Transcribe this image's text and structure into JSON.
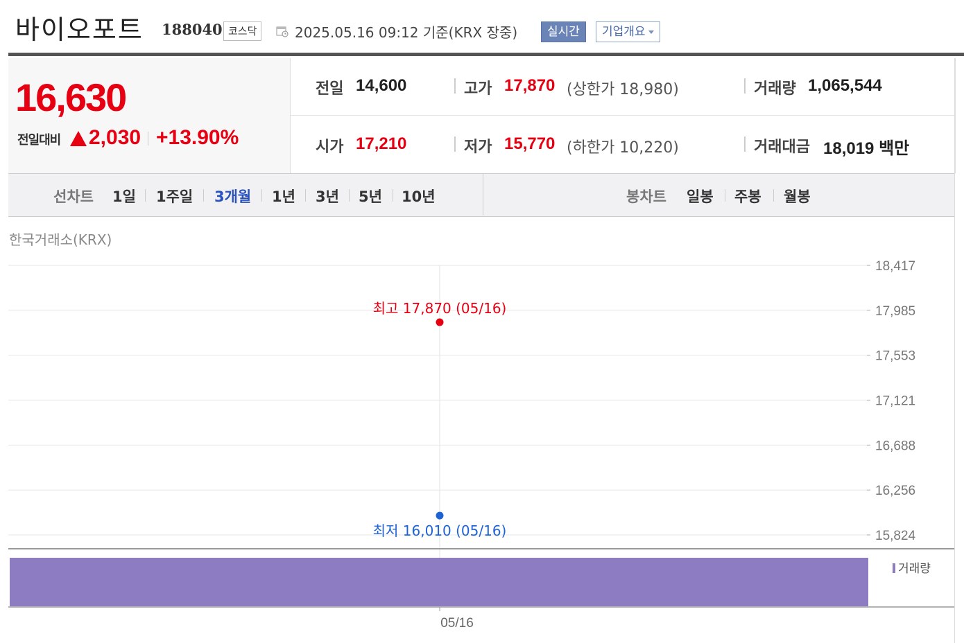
{
  "header": {
    "title": "바이오포트",
    "code": "188040",
    "market": "코스닥",
    "datetime": "2025.05.16 09:12  기준(KRX 장중)",
    "realtime_label": "실시간",
    "company_label": "기업개요"
  },
  "price": {
    "current": "16,630",
    "change_label": "전일대비",
    "change": "2,030",
    "change_pct": "+13.90%"
  },
  "stats": {
    "prev_close_label": "전일",
    "prev_close": "14,600",
    "high_label": "고가",
    "high": "17,870",
    "upper_limit_text": "(상한가 18,980)",
    "volume_label": "거래량",
    "volume": "1,065,544",
    "open_label": "시가",
    "open": "17,210",
    "low_label": "저가",
    "low": "15,770",
    "lower_limit_text": "(하한가 10,220)",
    "value_label": "거래대금",
    "value": "18,019 백만"
  },
  "tabs": {
    "line_label": "선차트",
    "line_tabs": [
      "1일",
      "1주일",
      "3개월",
      "1년",
      "3년",
      "5년",
      "10년"
    ],
    "active_tab": "3개월",
    "candle_label": "봉차트",
    "candle_tabs": [
      "일봉",
      "주봉",
      "월봉"
    ]
  },
  "chart": {
    "exchange_label": "한국거래소(KRX)",
    "volume_legend": "거래량",
    "colors": {
      "high": "#e60012",
      "low": "#1e63d6",
      "volume": "#8e7cc3",
      "grid": "#e6e6e6"
    }
  },
  "chart_data": {
    "type": "line",
    "x": [
      "05/16"
    ],
    "y_ticks": [
      18417,
      17985,
      17553,
      17121,
      16688,
      16256,
      15824
    ],
    "ylim": [
      15824,
      18417
    ],
    "annotations": [
      {
        "label": "최고 17,870 (05/16)",
        "x": "05/16",
        "y": 17870,
        "kind": "high"
      },
      {
        "label": "최저 16,010 (05/16)",
        "x": "05/16",
        "y": 16010,
        "kind": "low"
      }
    ],
    "volume": {
      "name": "거래량",
      "x": [
        "05/16"
      ],
      "values": [
        1065544
      ]
    },
    "grid": true,
    "legend": "right"
  }
}
